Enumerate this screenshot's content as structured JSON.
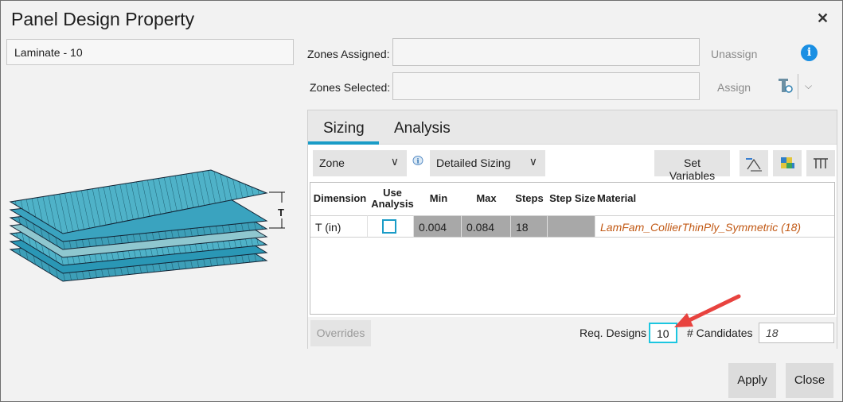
{
  "window": {
    "title": "Panel Design Property",
    "close_glyph": "✕"
  },
  "name_field": {
    "value": "Laminate - 10"
  },
  "zones": {
    "assigned_label": "Zones Assigned:",
    "selected_label": "Zones Selected:",
    "assigned_value": "",
    "selected_value": "",
    "unassign_label": "Unassign",
    "assign_label": "Assign"
  },
  "diagram": {
    "thickness_label": "T"
  },
  "tabs": [
    {
      "label": "Sizing",
      "active": true
    },
    {
      "label": "Analysis",
      "active": false
    }
  ],
  "toolbar": {
    "zone_select": "Zone",
    "mode_select": "Detailed Sizing",
    "set_variables_label": "Set Variables"
  },
  "table": {
    "headers": [
      "Dimension",
      "Use Analysis",
      "Min",
      "Max",
      "Steps",
      "Step Size",
      "Material"
    ],
    "rows": [
      {
        "dimension": "T (in)",
        "use_analysis": false,
        "min": "0.004",
        "max": "0.084",
        "steps": "18",
        "step_size": "",
        "material": "LamFam_CollierThinPly_Symmetric (18)"
      }
    ]
  },
  "footer": {
    "overrides_label": "Overrides",
    "req_designs_label": "Req. Designs",
    "req_designs_value": "10",
    "candidates_label": "# Candidates",
    "candidates_value": "18"
  },
  "actions": {
    "apply_label": "Apply",
    "close_label": "Close"
  },
  "colors": {
    "accent": "#1a9cc7",
    "highlight": "#1cc6e0",
    "material_text": "#c25a16",
    "annotation_arrow": "#e8433f"
  }
}
